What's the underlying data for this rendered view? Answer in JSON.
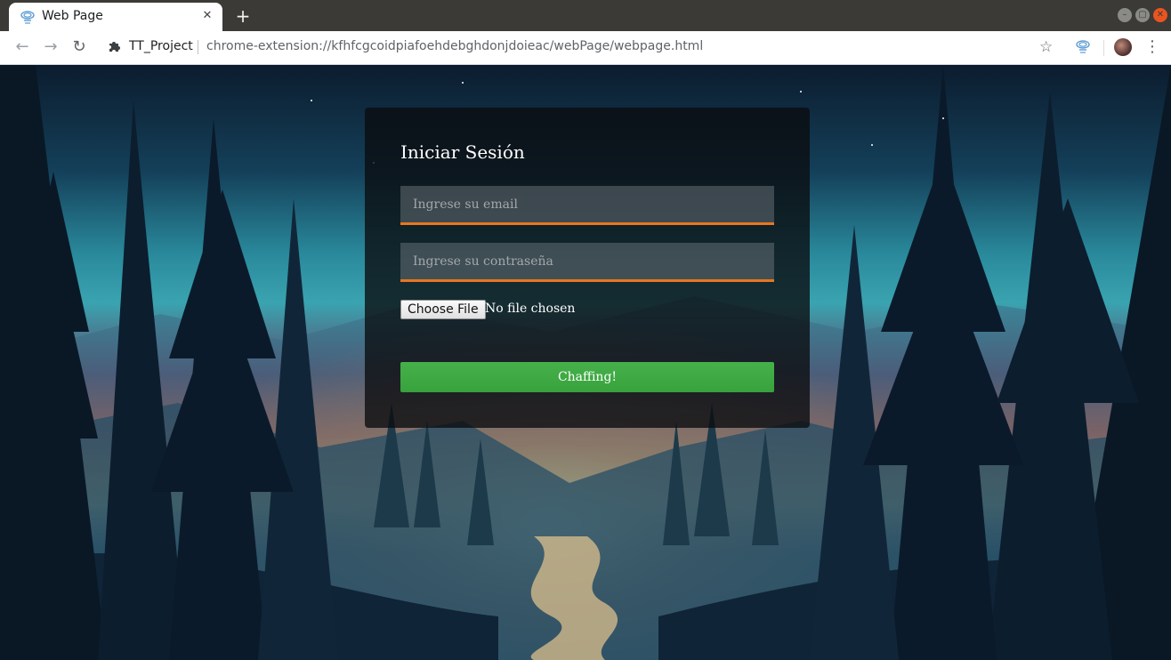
{
  "browser": {
    "tab_title": "Web Page",
    "tab_close": "✕",
    "new_tab": "+",
    "site_name": "TT_Project",
    "url": "chrome-extension://kfhfcgcoidpiafoehdebghdonjdoieac/webPage/webpage.html",
    "window_controls": {
      "minimize": "–",
      "maximize": "▢",
      "close": "✕"
    },
    "icons": {
      "back": "←",
      "forward": "→",
      "reload": "↻",
      "star": "☆",
      "menu": "⋮",
      "favicon": "spiral-icon",
      "extension": "puzzle-icon",
      "profile": "avatar"
    },
    "accent_close": "#e95420"
  },
  "login": {
    "title": "Iniciar Sesión",
    "email_placeholder": "Ingrese su email",
    "password_placeholder": "Ingrese su contraseña",
    "file_button": "Choose File",
    "file_status": "No file chosen",
    "submit": "Chaffing!",
    "colors": {
      "underline": "#e8761f",
      "submit": "#3ea842"
    }
  }
}
